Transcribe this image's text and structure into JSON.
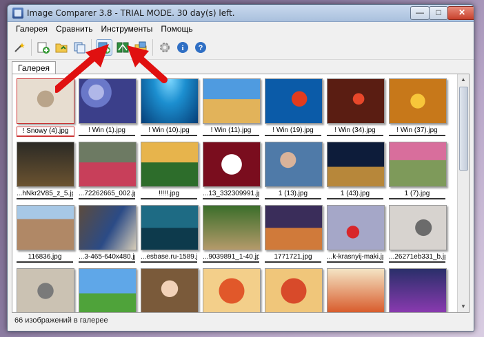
{
  "window": {
    "title": "Image Comparer 3.8 - TRIAL MODE. 30 day(s) left.",
    "minimize": "—",
    "maximize": "□",
    "close": "✕"
  },
  "menu": [
    "Галерея",
    "Сравнить",
    "Инструменты",
    "Помощь"
  ],
  "toolbar": {
    "buttons": [
      "wand-icon",
      "add-gallery-icon",
      "open-folder-icon",
      "compare-icon",
      "compare-gallery-icon",
      "compare-two-icon",
      "compare-folders-icon",
      "settings-icon",
      "info-icon",
      "help-icon"
    ]
  },
  "tabs": [
    "Галерея"
  ],
  "gallery": {
    "items": [
      {
        "label": "! Snowy (4).jpg"
      },
      {
        "label": "! Win (1).jpg"
      },
      {
        "label": "! Win (10).jpg"
      },
      {
        "label": "! Win (11).jpg"
      },
      {
        "label": "! Win (19).jpg"
      },
      {
        "label": "! Win (34).jpg"
      },
      {
        "label": "! Win (37).jpg"
      },
      {
        "label": "...hNkr2V85_z_5.jpg"
      },
      {
        "label": "...72262665_002.jpg"
      },
      {
        "label": "!!!!!.jpg"
      },
      {
        "label": "...13_332309991.jpg"
      },
      {
        "label": "1 (13).jpg"
      },
      {
        "label": "1 (43).jpg"
      },
      {
        "label": "1 (7).jpg"
      },
      {
        "label": "116836.jpg"
      },
      {
        "label": "...3-465-640x480.jpg"
      },
      {
        "label": "...esbase.ru-1589.jpg"
      },
      {
        "label": "...9039891_1-40.jpg"
      },
      {
        "label": "1771721.jpg"
      },
      {
        "label": "...k-krasnyij-maki.jpg"
      },
      {
        "label": "...26271eb331_b.jpg"
      },
      {
        "label": ""
      },
      {
        "label": ""
      },
      {
        "label": ""
      },
      {
        "label": ""
      },
      {
        "label": ""
      },
      {
        "label": ""
      },
      {
        "label": ""
      }
    ]
  },
  "status": "66 изображений в галерее"
}
